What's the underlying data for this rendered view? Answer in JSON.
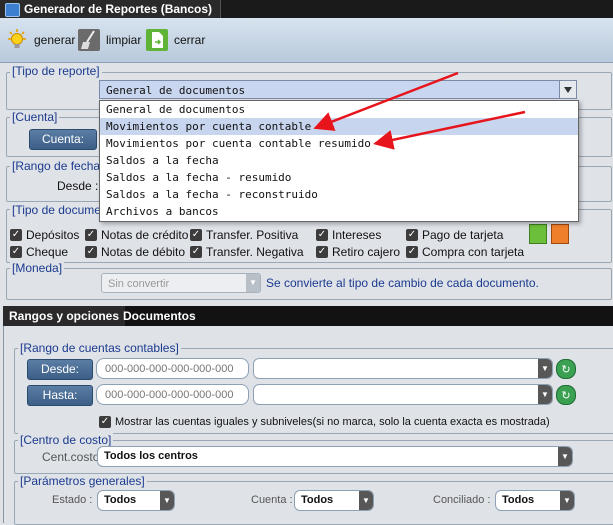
{
  "window": {
    "title": "Generador de Reportes (Bancos)"
  },
  "toolbar": {
    "generate": "generar",
    "clear": "limpiar",
    "close": "cerrar"
  },
  "tipo_reporte": {
    "legend": "[Tipo de reporte]",
    "selected": "General de documentos",
    "options": [
      "General de documentos",
      "Movimientos por cuenta contable",
      "Movimientos por cuenta contable resumido",
      "Saldos a la fecha",
      "Saldos a la fecha - resumido",
      "Saldos a la fecha - reconstruido",
      "Archivos a bancos"
    ],
    "highlighted_index": 1
  },
  "cuenta": {
    "legend": "[Cuenta]",
    "button": "Cuenta:"
  },
  "rango_fechas": {
    "legend": "[Rango de fechas",
    "desde": "Desde :"
  },
  "tipo_documento": {
    "legend": "[Tipo de documen",
    "checks": [
      "Depósitos",
      "Notas de crédito",
      "Transfer. Positiva",
      "Intereses",
      "Pago de tarjeta",
      "Cheque",
      "Notas de débito",
      "Transfer. Negativa",
      "Retiro cajero",
      "Compra con tarjeta"
    ]
  },
  "moneda": {
    "legend": "[Moneda]",
    "selected": "Sin convertir",
    "note": "Se convierte al tipo de cambio de cada documento."
  },
  "tabs": {
    "rangos": "Rangos y opciones",
    "documentos": "Documentos"
  },
  "rango_cuentas": {
    "legend": "[Rango de cuentas contables]",
    "desde_btn": "Desde:",
    "hasta_btn": "Hasta:",
    "desde_placeholder": "000-000-000-000-000-000",
    "hasta_placeholder": "000-000-000-000-000-000",
    "mostrar": "Mostrar las cuentas iguales y subniveles(si no marca, solo la cuenta exacta es mostrada)"
  },
  "centro_costo": {
    "legend": "[Centro de costo]",
    "label": "Cent.costo:",
    "selected": "Todos los centros"
  },
  "parametros": {
    "legend": "[Parámetros generales]",
    "estado_label": "Estado :",
    "estado_value": "Todos",
    "cuenta_label": "Cuenta :",
    "cuenta_value": "Todos",
    "conciliado_label": "Conciliado :",
    "conciliado_value": "Todos"
  },
  "colors": {
    "annotation_arrow": "#e8141c",
    "legend_blue": "#1b3a8e",
    "combo_bg": "#c9d6ef"
  }
}
